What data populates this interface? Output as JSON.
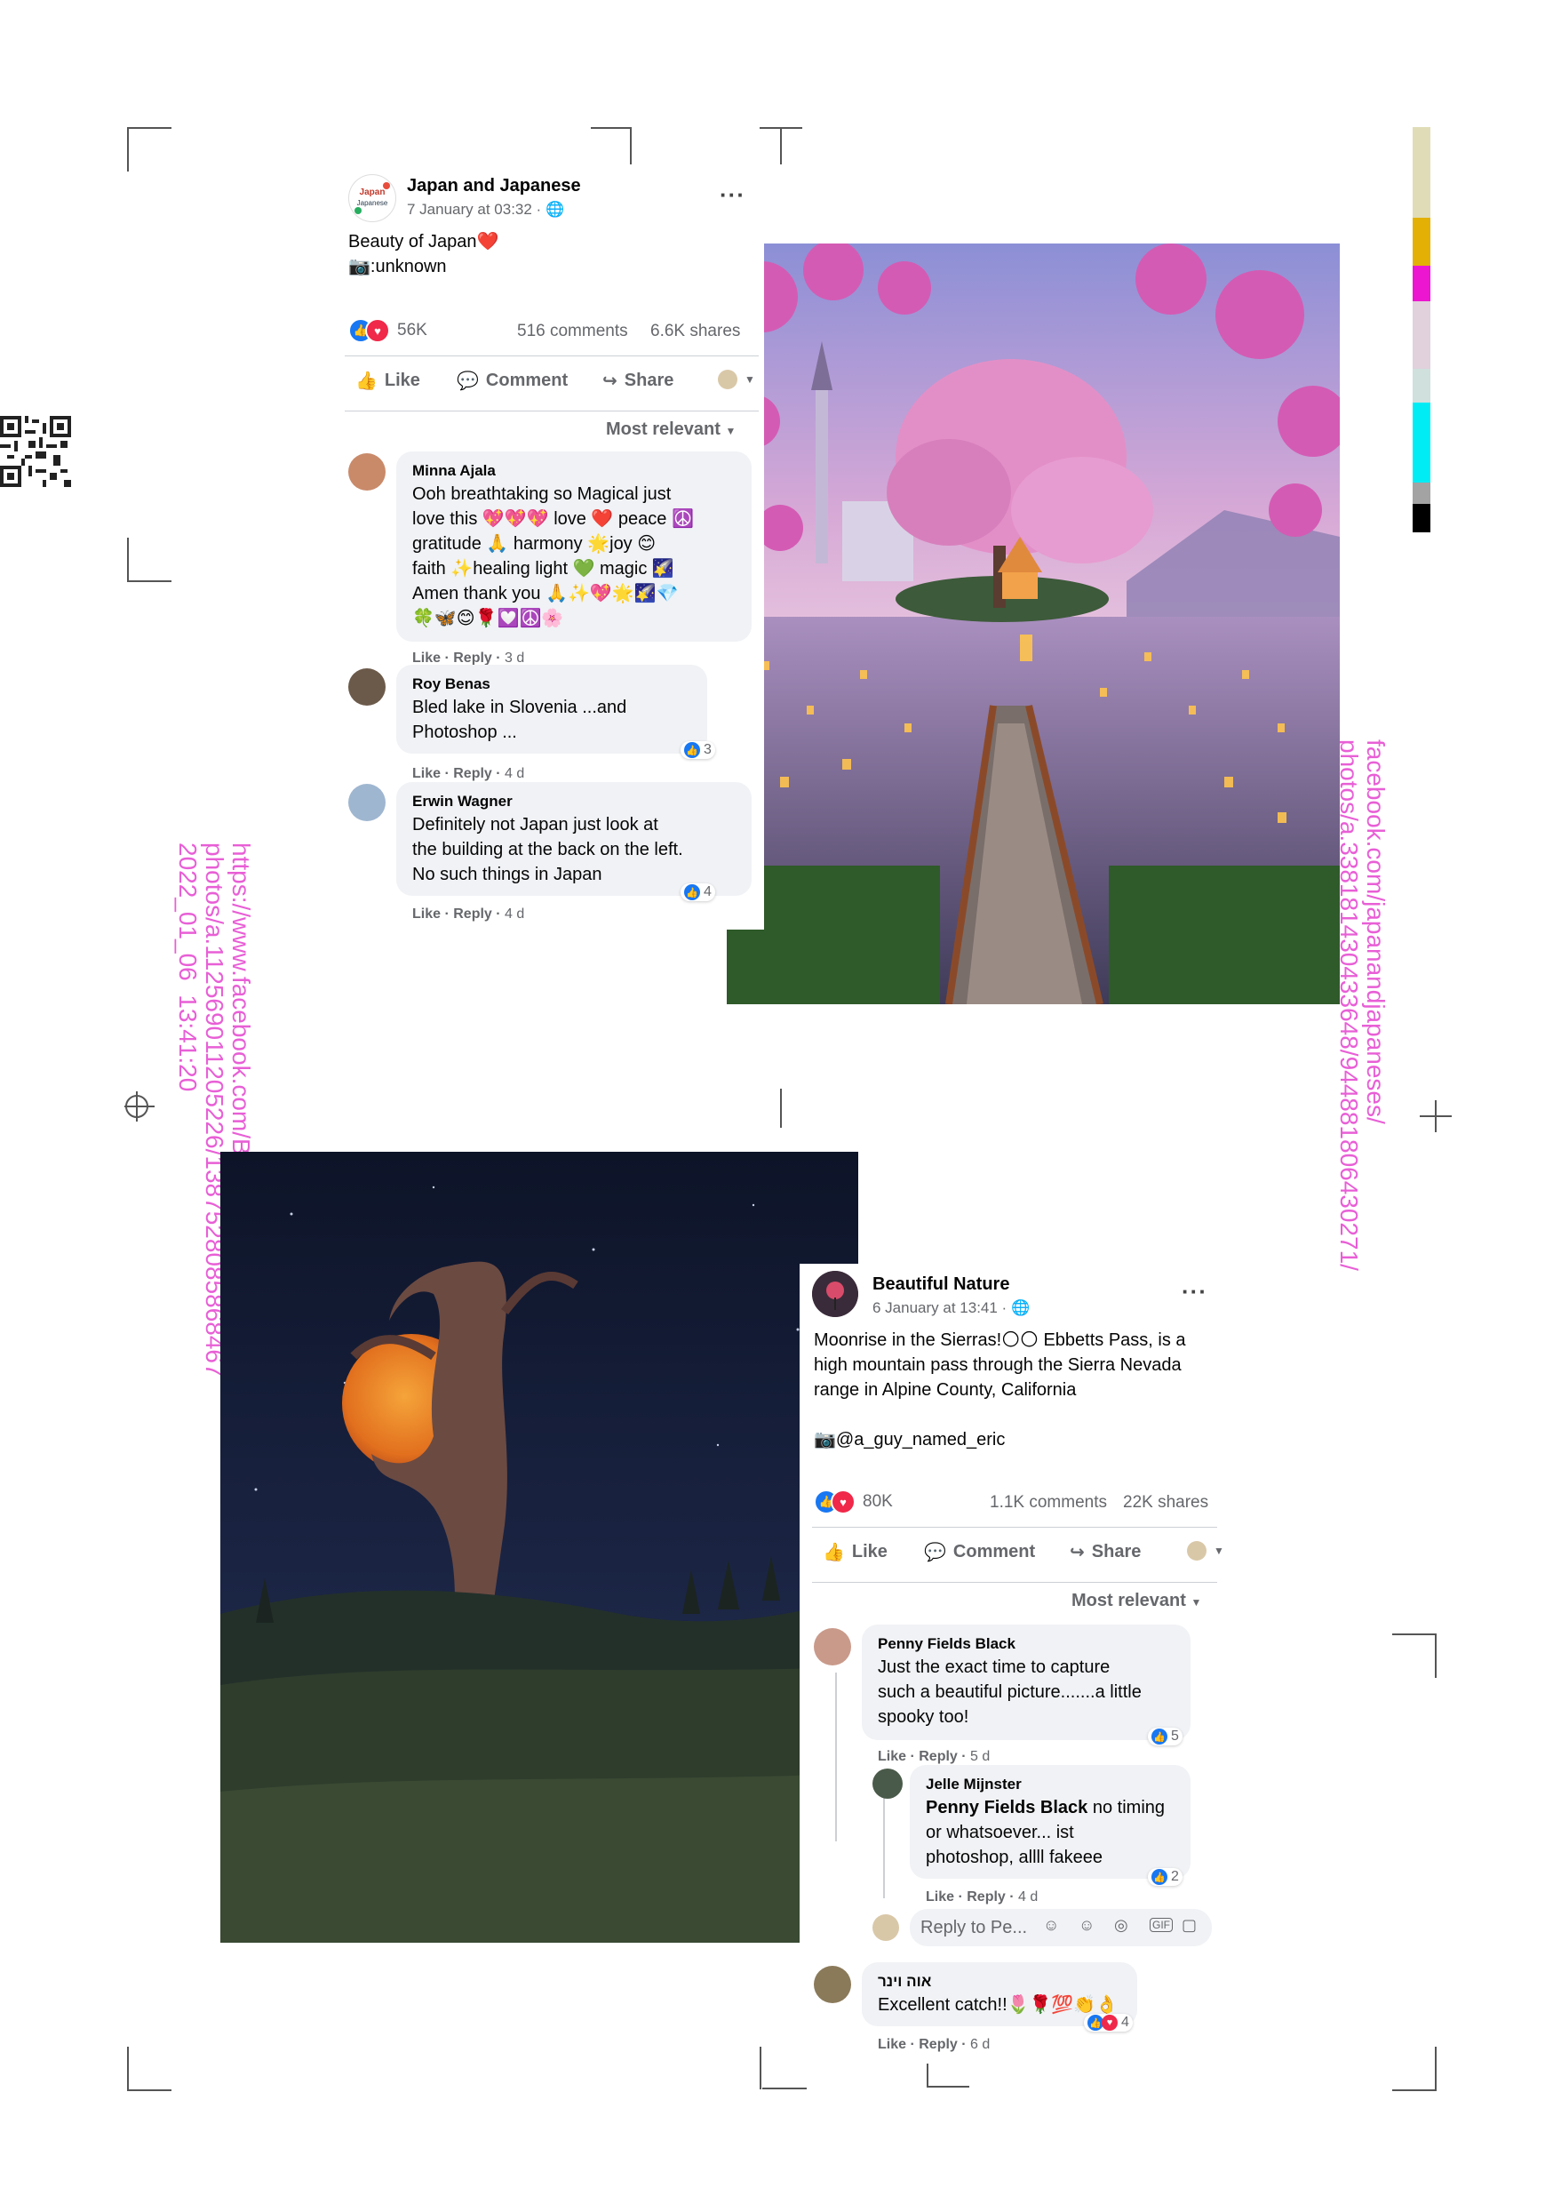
{
  "post1": {
    "page_name": "Japan and Japanese",
    "date": "7 January at 03:32 · ",
    "text": "Beauty of Japan❤️\n📷:unknown",
    "reaction_count": "56K",
    "comments": "516 comments",
    "shares": "6.6K shares",
    "actions": {
      "like": "Like",
      "comment": "Comment",
      "share": "Share"
    },
    "sort_label": "Most relevant",
    "comments_list": [
      {
        "name": "Minna Ajala",
        "text": "Ooh breathtaking so Magical just\nlove this 💖💖💖 love ❤️ peace ☮️\ngratitude 🙏 harmony 🌟joy 😊\nfaith ✨healing light 💚 magic 🌠\nAmen thank you 🙏✨💖🌟🌠💎\n🍀🦋😊🌹💟☮️🌸",
        "like": "Like",
        "reply": "Reply",
        "time": "3 d"
      },
      {
        "name": "Roy Benas",
        "text": "Bled lake in Slovenia ...and\nPhotoshop ...",
        "like": "Like",
        "reply": "Reply",
        "time": "4 d",
        "reactions": "3"
      },
      {
        "name": "Erwin Wagner",
        "text": "Definitely not Japan just look at\nthe building at the back on the left.\nNo such things in Japan",
        "like": "Like",
        "reply": "Reply",
        "time": "4 d",
        "reactions": "4"
      }
    ]
  },
  "post2": {
    "page_name": "Beautiful Nature",
    "date": "6 January at 13:41 · ",
    "text": "Moonrise in the Sierras!🌕🌕 Ebbetts Pass, is a\nhigh mountain pass through the Sierra Nevada\nrange in Alpine County, California\n\n📷@a_guy_named_eric",
    "reaction_count": "80K",
    "comments": "1.1K comments",
    "shares": "22K shares",
    "actions": {
      "like": "Like",
      "comment": "Comment",
      "share": "Share"
    },
    "sort_label": "Most relevant",
    "comments_list": [
      {
        "name": "Penny Fields Black",
        "text": "Just the exact time to capture\nsuch a beautiful picture.......a little\nspooky too!",
        "like": "Like",
        "reply": "Reply",
        "time": "5 d",
        "reactions": "5"
      },
      {
        "name": "Jelle Mijnster",
        "mention": "Penny Fields Black",
        "text": " no timing\nor whatsoever... ist\nphotoshop, allll fakeee",
        "like": "Like",
        "reply": "Reply",
        "time": "4 d",
        "reactions": "2"
      },
      {
        "name": "אוה וינר",
        "text": "Excellent catch!!🌷🌹💯👏👌",
        "like": "Like",
        "reply": "Reply",
        "time": "6 d",
        "reactions": "4"
      }
    ],
    "reply_placeholder": "Reply to Pe..."
  },
  "urls": {
    "left": "https://www.facebook.com/BeautifulNatureOfficialPage/\nphotos/a.112569011205226/1387528085868467\n2022_01_06  13:41:20",
    "right": "facebook.com/japanandjapaneses/\nphotos/a.338181430433648/944881806430271/"
  },
  "colors": {
    "accent_blue": "#1877f2",
    "love_red": "#f02849",
    "url_pink": "#e85fd6",
    "color_bar": [
      "#e0dcb8",
      "#e3b006",
      "#ec16d0",
      "#e0d1dc",
      "#cfe0dd",
      "#00ecf5",
      "#a3a3a3",
      "#000000"
    ]
  }
}
